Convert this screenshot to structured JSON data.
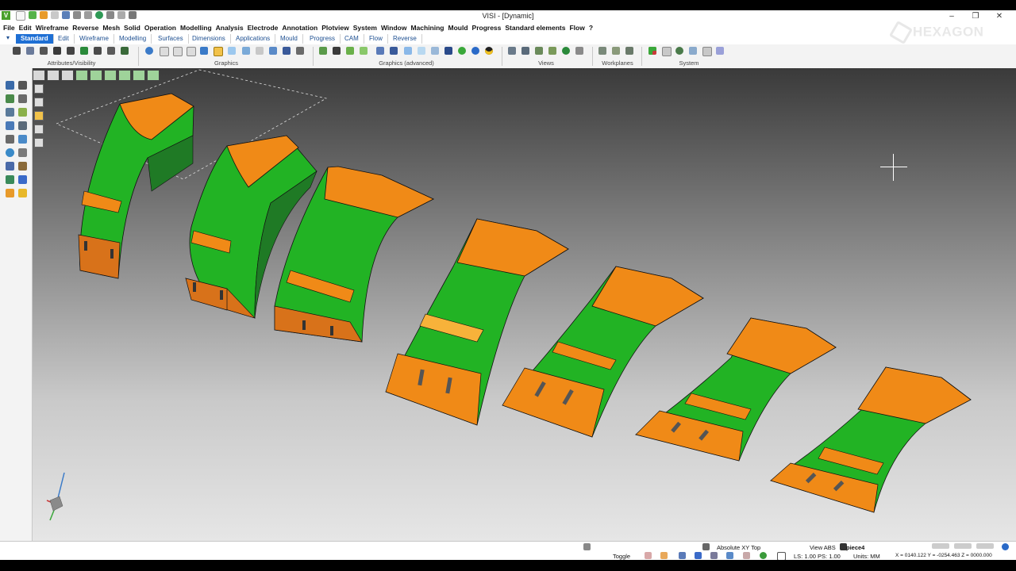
{
  "app": {
    "title": "VISI - [Dynamic]",
    "icon_letter": "V",
    "brand": "HEXAGON",
    "window_controls": [
      "–",
      "❐",
      "✕"
    ]
  },
  "menu": [
    "File",
    "Edit",
    "Wireframe",
    "Reverse",
    "Mesh",
    "Solid",
    "Operation",
    "Modelling",
    "Analysis",
    "Electrode",
    "Annotation",
    "Plotview",
    "System",
    "Window",
    "Machining",
    "Mould",
    "Progress",
    "Standard elements",
    "Flow",
    "?"
  ],
  "tabs": [
    "Standard",
    "Edit",
    "Wireframe",
    "Modelling",
    "Surfaces",
    "Dimensions",
    "Applications",
    "Mould",
    "Progress",
    "CAM",
    "Flow",
    "Reverse"
  ],
  "active_tab": "Standard",
  "ribbon_groups": [
    "Attributes/Visibility",
    "Graphics",
    "Graphics (advanced)",
    "Views",
    "Workplanes",
    "System"
  ],
  "status": {
    "toggle": "Toggle",
    "plane": "Absolute XY Top",
    "view": "View ABS",
    "piece": "piece4",
    "ls_ps": "LS: 1.00 PS: 1.00",
    "units": "Units: MM",
    "coords": "X = 0140.122 Y = -0254.463 Z = 0000.000"
  },
  "colors": {
    "part_orange": "#f08a17",
    "part_green": "#22b324",
    "part_dark_green": "#1f7a25",
    "accent_tab": "#1e6fd4"
  }
}
